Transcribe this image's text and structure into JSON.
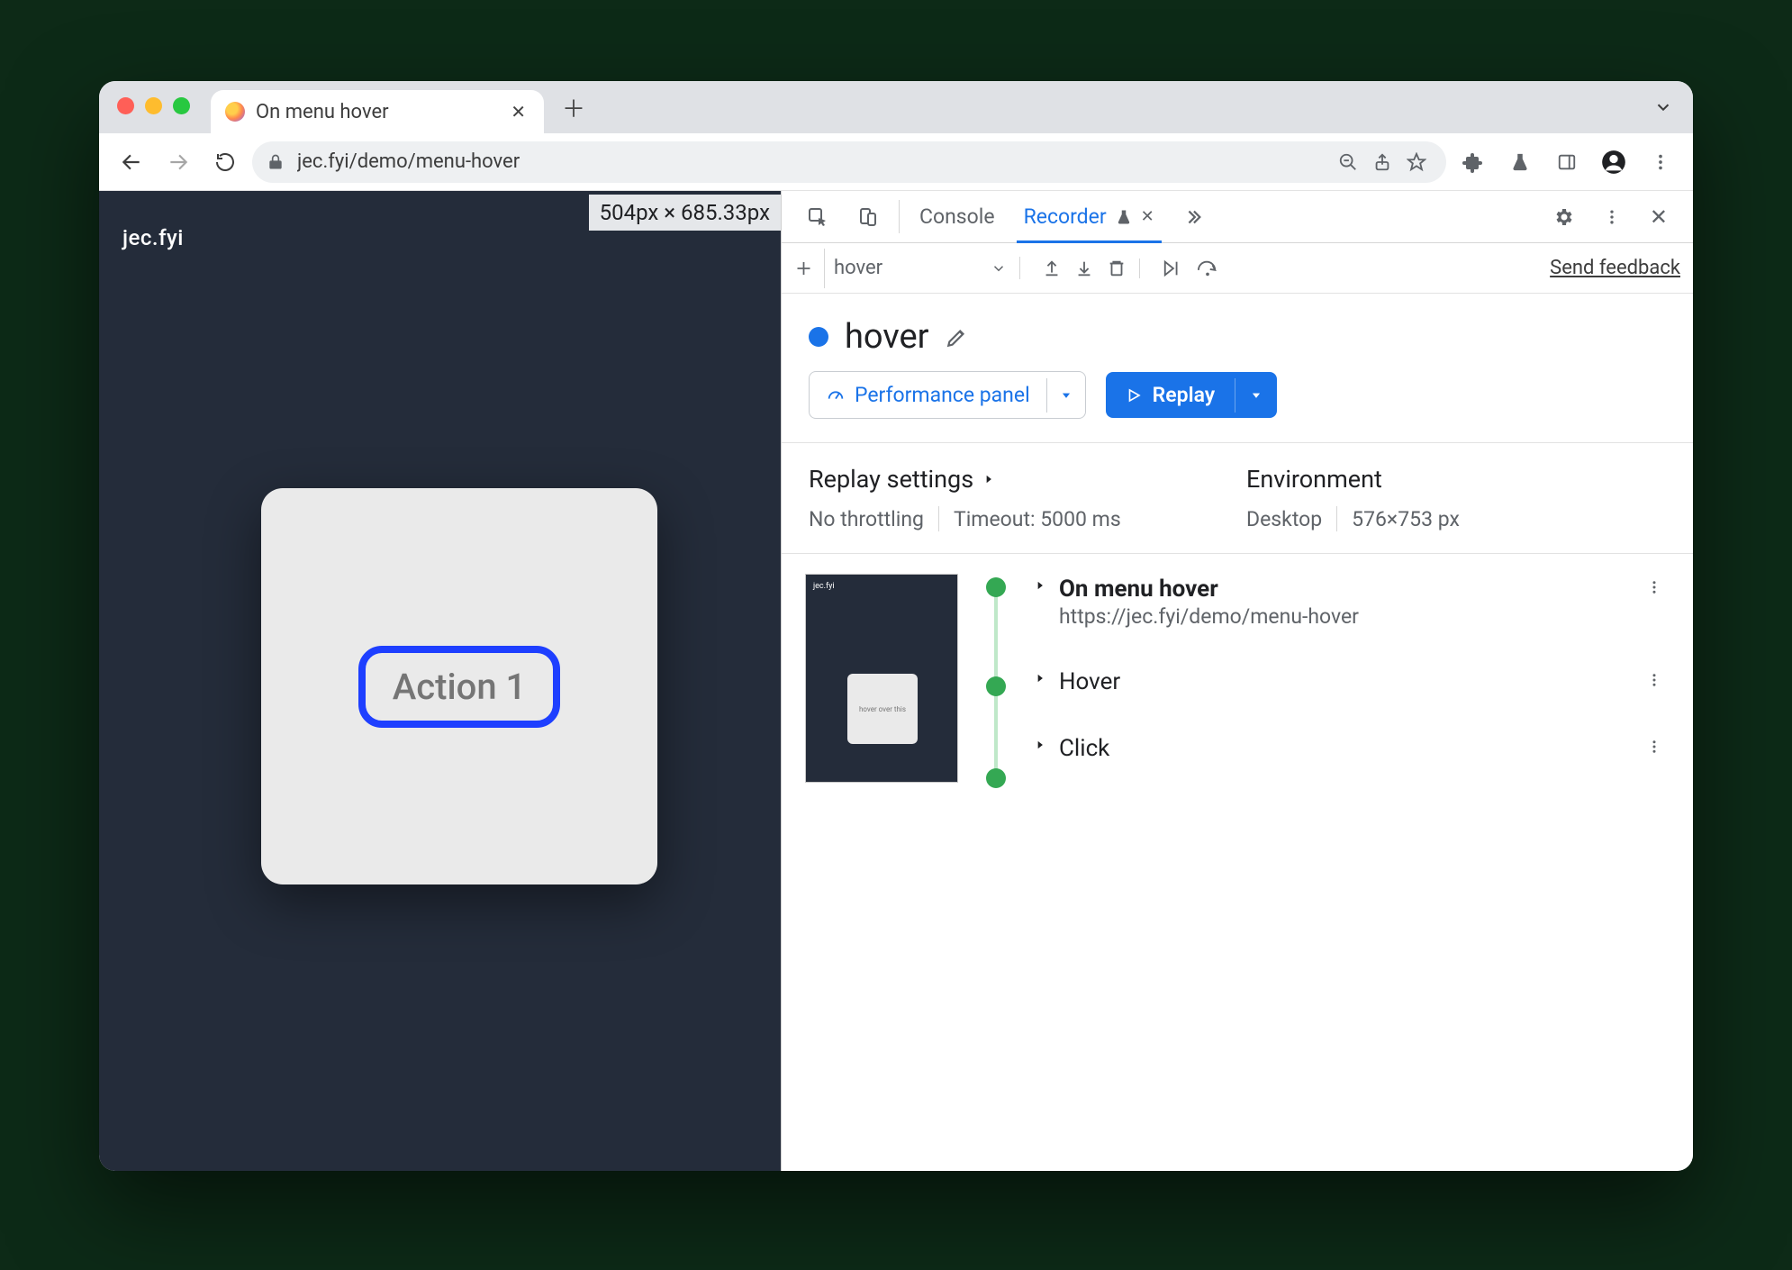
{
  "tab": {
    "title": "On menu hover"
  },
  "toolbar": {
    "lock": "lock",
    "url": "jec.fyi/demo/menu-hover"
  },
  "page": {
    "brand": "jec.fyi",
    "dimensions": "504px × 685.33px",
    "action_label": "Action 1"
  },
  "devtools": {
    "tabs": {
      "console": "Console",
      "recorder": "Recorder"
    },
    "bar2": {
      "recording_name": "hover",
      "feedback": "Send feedback"
    },
    "recording": {
      "name": "hover",
      "perf_button": "Performance panel",
      "replay_button": "Replay"
    },
    "settings": {
      "replay_title": "Replay settings",
      "env_title": "Environment",
      "throttle": "No throttling",
      "timeout": "Timeout: 5000 ms",
      "device": "Desktop",
      "viewport": "576×753 px"
    },
    "steps": [
      {
        "title": "On menu hover",
        "subtitle": "https://jec.fyi/demo/menu-hover"
      },
      {
        "title": "Hover"
      },
      {
        "title": "Click"
      }
    ]
  }
}
